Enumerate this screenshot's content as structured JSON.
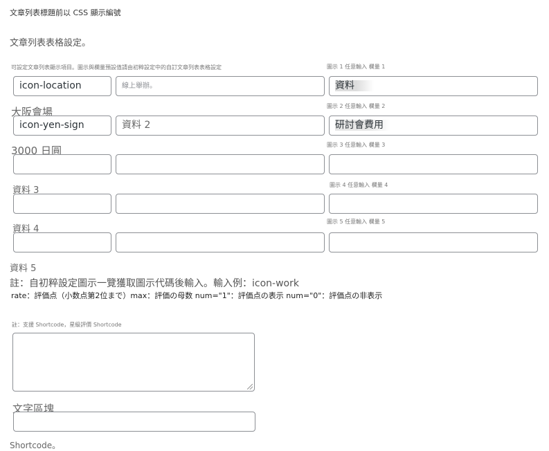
{
  "header": {
    "section_title": "文章列表標題前以 CSS 顯示編號",
    "table_heading": "文章列表表格設定。"
  },
  "table": {
    "left_hint": "可設定文章列表顯示項目。圖示與欄量預設值請由初粹設定中的自訂文章列表表格設定",
    "rows": [
      {
        "icon_value": "icon-location",
        "text_value": "",
        "text_placeholder": "線上舉辦。",
        "label_hint": "圖示 1 任意輸入 欄量 1",
        "label_value": "資料",
        "ghost_label": "大阪會場"
      },
      {
        "icon_value": "icon-yen-sign",
        "text_value": "資料 2",
        "text_placeholder": "",
        "label_hint": "圖示 2 任意輸入 欄量 2",
        "label_value": "研討會費用",
        "ghost_label": "3000 日圓"
      },
      {
        "icon_value": "",
        "text_value": "",
        "text_placeholder": "",
        "label_hint": "圖示 3 任意輸入 欄量 3",
        "label_value": "",
        "ghost_label": "資料 3"
      },
      {
        "icon_value": "",
        "text_value": "",
        "text_placeholder": "",
        "label_hint": "圖示 4 任意輸入 欄量 4",
        "label_value": "",
        "ghost_label": "資料 4"
      },
      {
        "icon_value": "",
        "text_value": "",
        "text_placeholder": "",
        "label_hint": "圖示 5 任意輸入 欄量 5",
        "label_value": "",
        "ghost_label": "資料 5"
      }
    ]
  },
  "notes": {
    "icon_note": "註：自初粹設定圖示一覽獲取圖示代碼後輸入。輸入例：icon-work",
    "rate_note": "rate：評価点（小数点第2位まで）max：評価の母数 num=\"1\"：評価点の表示 num=\"0\"：評価点の非表示"
  },
  "shortcode": {
    "hint": "註：支援 Shortcode，星級評價 Shortcode",
    "textarea_value": "",
    "ghost_label": "文字區塊",
    "input_value": "",
    "footer_note": "Shortcode。"
  }
}
